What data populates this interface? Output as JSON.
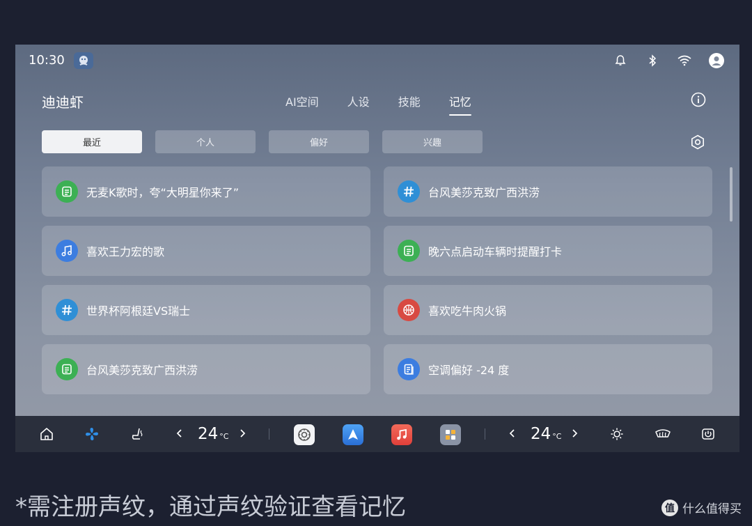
{
  "status": {
    "time": "10:30",
    "icons": [
      "assistant-avatar-icon",
      "bell-icon",
      "bluetooth-icon",
      "wifi-icon",
      "user-icon"
    ]
  },
  "app": {
    "title": "迪迪虾",
    "tabs": [
      {
        "label": "AI空间"
      },
      {
        "label": "人设"
      },
      {
        "label": "技能"
      },
      {
        "label": "记忆",
        "active": true
      }
    ]
  },
  "filters": [
    {
      "label": "最近",
      "active": true
    },
    {
      "label": "个人"
    },
    {
      "label": "偏好"
    },
    {
      "label": "兴趣"
    }
  ],
  "memories": [
    {
      "icon": "note-icon",
      "color": "#3cb054",
      "text": "无麦K歌时，夸“大明星你来了”"
    },
    {
      "icon": "hashtag-icon",
      "color": "#2f8fd6",
      "text": "台风美莎克致广西洪涝"
    },
    {
      "icon": "music-note-icon",
      "color": "#3c7de0",
      "text": "喜欢王力宏的歌"
    },
    {
      "icon": "note-icon",
      "color": "#3cb054",
      "text": "晚六点启动车辆时提醒打卡"
    },
    {
      "icon": "hashtag-icon",
      "color": "#2f8fd6",
      "text": "世界杯阿根廷VS瑞士"
    },
    {
      "icon": "basketball-icon",
      "color": "#d84a42",
      "text": "喜欢吃牛肉火锅"
    },
    {
      "icon": "note-icon",
      "color": "#3cb054",
      "text": "台风美莎克致广西洪涝"
    },
    {
      "icon": "document-icon",
      "color": "#3c7de0",
      "text": "空调偏好 -24 度"
    }
  ],
  "dock": {
    "left_temp": "24",
    "right_temp": "24",
    "temp_unit": "°C"
  },
  "caption": "*需注册声纹，通过声纹验证查看记忆",
  "watermark": {
    "logo": "值",
    "text": "什么值得买"
  }
}
